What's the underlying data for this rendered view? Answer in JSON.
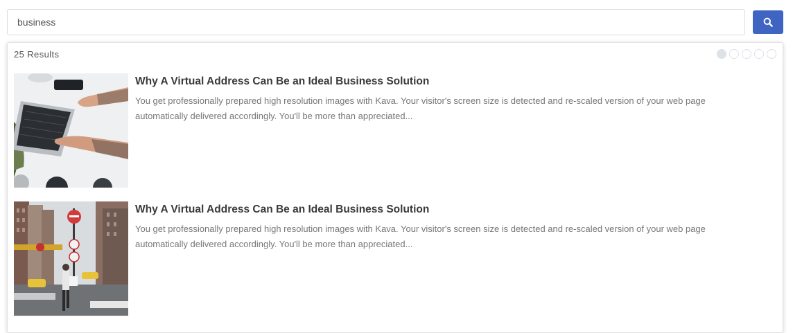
{
  "search": {
    "value": "business",
    "button_icon": "search-icon",
    "button_color": "#3f64c1"
  },
  "results": {
    "count_label": "25 Results",
    "pager": {
      "total_pages": 5,
      "active_page": 1
    },
    "items": [
      {
        "title": "Why A Virtual Address Can Be an Ideal Business Solution",
        "excerpt": "You get professionally prepared high resolution images with Kava. Your visitor's screen size is detected and re-scaled version of your web page automatically delivered accordingly. You'll be more than appreciated...",
        "thumbnail": "laptop-desk-photo"
      },
      {
        "title": "Why A Virtual Address Can Be an Ideal Business Solution",
        "excerpt": "You get professionally prepared high resolution images with Kava. Your visitor's screen size is detected and re-scaled version of your web page automatically delivered accordingly. You'll be more than appreciated...",
        "thumbnail": "city-street-photo"
      }
    ]
  }
}
